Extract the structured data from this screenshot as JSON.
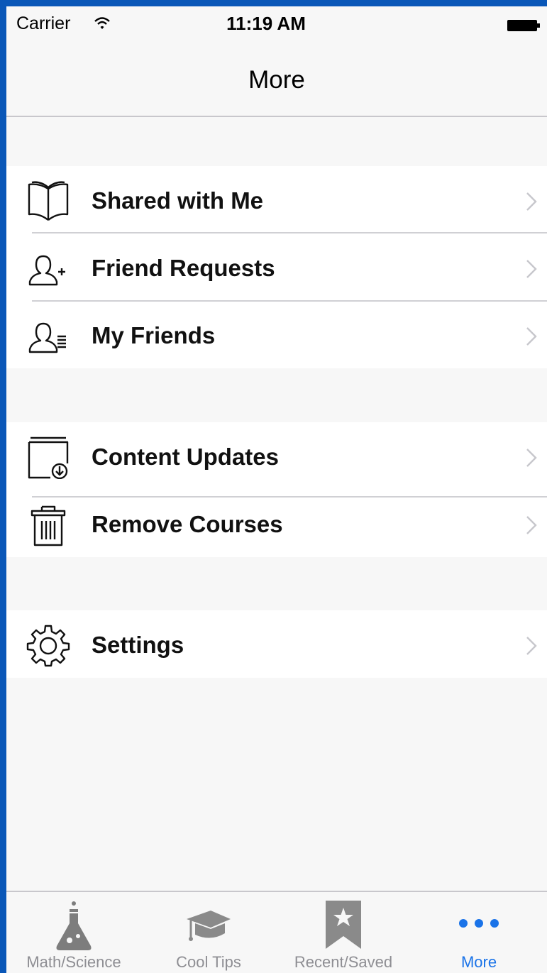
{
  "status_bar": {
    "carrier": "Carrier",
    "time": "11:19 AM"
  },
  "nav": {
    "title": "More"
  },
  "groups": [
    {
      "items": [
        {
          "label": "Shared with Me",
          "icon": "open-book-icon"
        },
        {
          "label": "Friend Requests",
          "icon": "person-add-icon"
        },
        {
          "label": "My Friends",
          "icon": "person-list-icon"
        }
      ]
    },
    {
      "items": [
        {
          "label": "Content Updates",
          "icon": "download-folder-icon"
        },
        {
          "label": "Remove Courses",
          "icon": "trash-icon"
        }
      ]
    },
    {
      "items": [
        {
          "label": "Settings",
          "icon": "gear-icon"
        }
      ]
    }
  ],
  "tabs": [
    {
      "label": "Math/Science",
      "icon": "flask-icon",
      "active": false
    },
    {
      "label": "Cool Tips",
      "icon": "graduation-cap-icon",
      "active": false
    },
    {
      "label": "Recent/Saved",
      "icon": "bookmark-star-icon",
      "active": false
    },
    {
      "label": "More",
      "icon": "more-dots-icon",
      "active": true
    }
  ],
  "colors": {
    "frame": "#0a57b8",
    "accent": "#1a73e8",
    "inactive_tab": "#8e8e93",
    "background": "#f7f7f7"
  }
}
